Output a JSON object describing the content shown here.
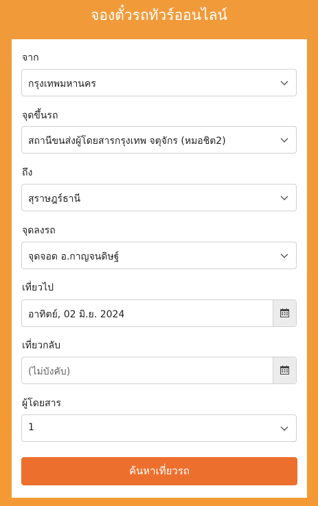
{
  "header": {
    "title": "จองตั๋วรถทัวร์ออนไลน์"
  },
  "form": {
    "from": {
      "label": "จาก",
      "value": "กรุงเทพมหานคร"
    },
    "pickup": {
      "label": "จุดขึ้นรถ",
      "value": "สถานีขนส่งผู้โดยสารกรุงเทพ จตุจักร (หมอชิต2)"
    },
    "to": {
      "label": "ถึง",
      "value": "สุราษฎร์ธานี"
    },
    "dropoff": {
      "label": "จุดลงรถ",
      "value": "จุดจอด อ.กาญจนดิษฐ์"
    },
    "depart": {
      "label": "เที่ยวไป",
      "value": "อาทิตย์, 02 มิ.ย. 2024"
    },
    "return": {
      "label": "เที่ยวกลับ",
      "placeholder": "(ไม่บังคับ)"
    },
    "passengers": {
      "label": "ผู้โดยสาร",
      "value": "1"
    },
    "search_label": "ค้นหาเที่ยวรถ"
  },
  "colors": {
    "background": "#f19a3a",
    "button": "#ec6f2d",
    "addon": "#ececec"
  },
  "icons": {
    "select": "chevron-down-icon",
    "date": "calendar-icon"
  }
}
